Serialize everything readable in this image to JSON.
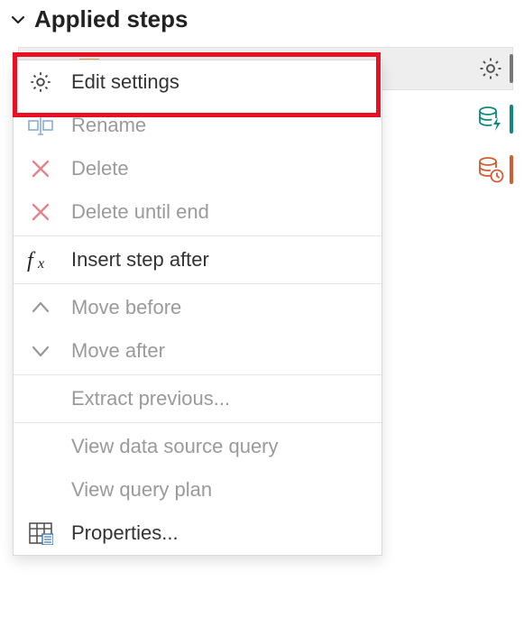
{
  "header": {
    "title": "Applied steps"
  },
  "side_icons": [
    {
      "name": "gear-icon",
      "bar_color": "#777777"
    },
    {
      "name": "database-flash-icon",
      "bar_color": "#0f8a7e"
    },
    {
      "name": "database-clock-icon",
      "bar_color": "#d25c2f"
    }
  ],
  "menu": {
    "items": [
      {
        "key": "edit_settings",
        "label": "Edit settings",
        "icon": "gear-icon",
        "enabled": true
      },
      {
        "key": "rename",
        "label": "Rename",
        "icon": "rename-icon",
        "enabled": false
      },
      {
        "key": "delete",
        "label": "Delete",
        "icon": "delete-x-icon",
        "enabled": false
      },
      {
        "key": "delete_until_end",
        "label": "Delete until end",
        "icon": "delete-x-icon",
        "enabled": false
      },
      {
        "key": "sep1",
        "separator": true
      },
      {
        "key": "insert_after",
        "label": "Insert step after",
        "icon": "fx-icon",
        "enabled": true
      },
      {
        "key": "sep2",
        "separator": true
      },
      {
        "key": "move_before",
        "label": "Move before",
        "icon": "chevron-up-icon",
        "enabled": false
      },
      {
        "key": "move_after",
        "label": "Move after",
        "icon": "chevron-down-icon",
        "enabled": false
      },
      {
        "key": "sep3",
        "separator": true
      },
      {
        "key": "extract_prev",
        "label": "Extract previous...",
        "icon": "",
        "enabled": false
      },
      {
        "key": "sep4",
        "separator": true
      },
      {
        "key": "view_source",
        "label": "View data source query",
        "icon": "",
        "enabled": false
      },
      {
        "key": "view_plan",
        "label": "View query plan",
        "icon": "",
        "enabled": false
      },
      {
        "key": "properties",
        "label": "Properties...",
        "icon": "table-grid-icon",
        "enabled": true
      }
    ]
  },
  "colors": {
    "highlight": "#e81123",
    "disabled_text": "#9a9a9a"
  }
}
